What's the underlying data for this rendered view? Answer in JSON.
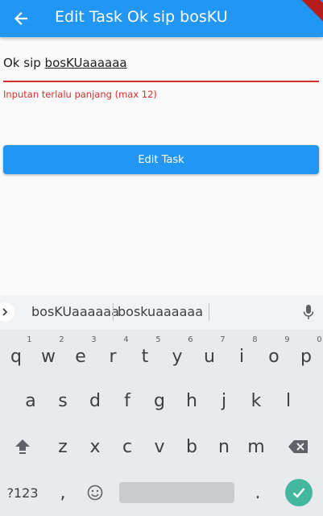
{
  "app_bar": {
    "title": "Edit Task Ok sip bosKU",
    "back_icon": "arrow-left-icon"
  },
  "form": {
    "field_value_plain": "Ok sip ",
    "field_value_composing": "bosKUaaaaaa",
    "error_text": "Inputan terlalu panjang (max 12)",
    "error_color": "#d32f2f"
  },
  "button": {
    "label": "Edit Task",
    "color": "#2196f3"
  },
  "keyboard": {
    "suggestions": [
      "bosKUaaaaaa",
      "boskuaaaaaa"
    ],
    "row1": [
      {
        "k": "q",
        "n": "1"
      },
      {
        "k": "w",
        "n": "2"
      },
      {
        "k": "e",
        "n": "3"
      },
      {
        "k": "r",
        "n": "4"
      },
      {
        "k": "t",
        "n": "5"
      },
      {
        "k": "y",
        "n": "6"
      },
      {
        "k": "u",
        "n": "7"
      },
      {
        "k": "i",
        "n": "8"
      },
      {
        "k": "o",
        "n": "9"
      },
      {
        "k": "p",
        "n": "0"
      }
    ],
    "row2": [
      "a",
      "s",
      "d",
      "f",
      "g",
      "h",
      "j",
      "k",
      "l"
    ],
    "row3": [
      "z",
      "x",
      "c",
      "v",
      "b",
      "n",
      "m"
    ],
    "symbols_label": "?123",
    "comma": ",",
    "period": "."
  }
}
